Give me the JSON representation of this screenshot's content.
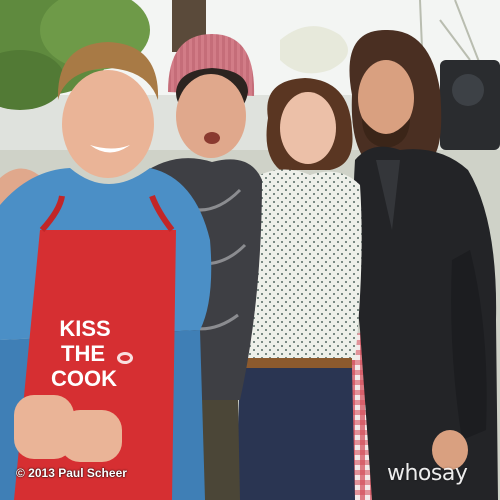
{
  "photo": {
    "apron_text": [
      "KISS",
      "THE",
      "COOK"
    ],
    "copyright": "© 2013 Paul Scheer",
    "watermark": "whosay"
  }
}
